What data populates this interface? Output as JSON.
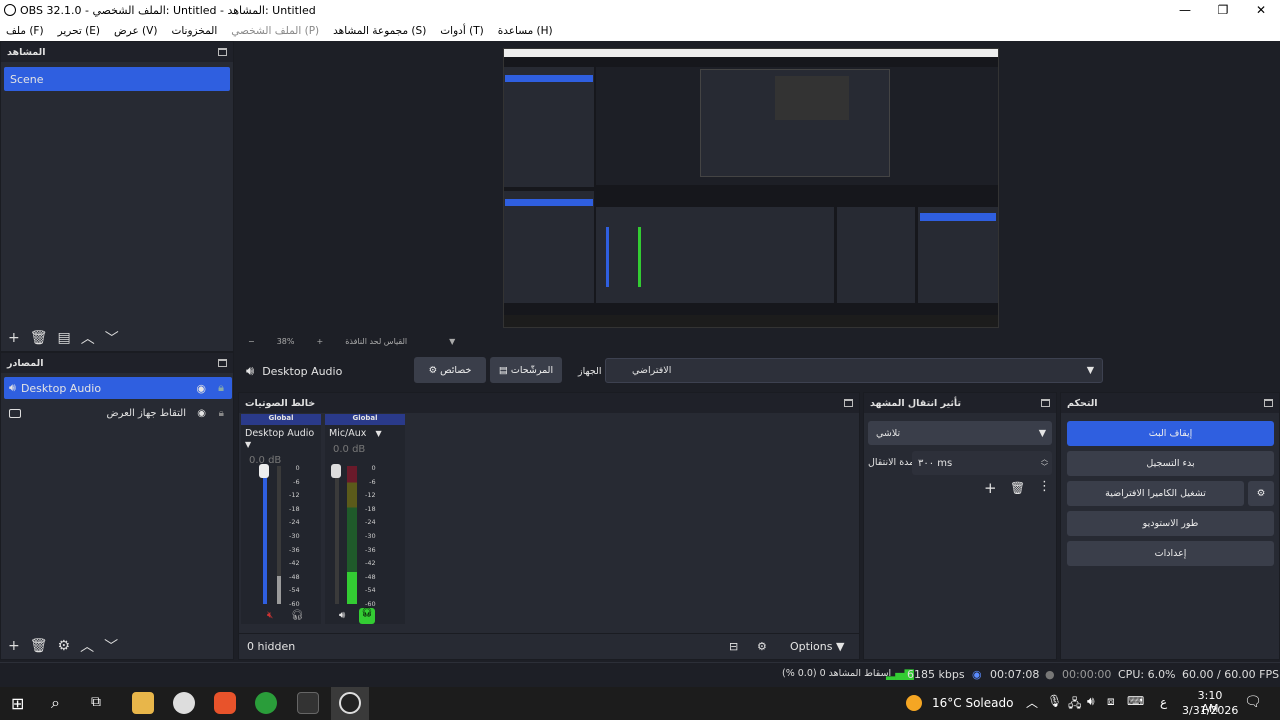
{
  "window": {
    "title": "OBS 32.1.0 - الملف الشخصي: Untitled - المشاهد: Untitled",
    "controls": [
      "—",
      "❐",
      "✕"
    ]
  },
  "menu": [
    {
      "label": "ملف (F)",
      "enabled": true
    },
    {
      "label": "تحرير (E)",
      "enabled": true
    },
    {
      "label": "عرض (V)",
      "enabled": true
    },
    {
      "label": "المخزونات",
      "enabled": true
    },
    {
      "label": "الملف الشخصي (P)",
      "enabled": false
    },
    {
      "label": "مجموعة المشاهد (S)",
      "enabled": true
    },
    {
      "label": "أدوات (T)",
      "enabled": true
    },
    {
      "label": "مساعدة (H)",
      "enabled": true
    }
  ],
  "scenes": {
    "header": "المشاهد",
    "items": [
      "Scene"
    ],
    "selected": 0
  },
  "sources": {
    "header": "المصادر",
    "items": [
      {
        "name": "Desktop Audio",
        "type": "audio",
        "selected": true
      },
      {
        "name": "التقاط جهاز العرض",
        "type": "display",
        "selected": false
      }
    ]
  },
  "preview": {
    "zoom": "38%",
    "zoom_label": "القياس لحد النافذة"
  },
  "context": {
    "source_name": "Desktop Audio",
    "properties": "خصائص",
    "filters": "المرشّحات",
    "device_label": "الجهاز",
    "device_value": "الافتراضي"
  },
  "mixer": {
    "header": "خالط الصوتيات",
    "channels": [
      {
        "scope": "Global",
        "name": "Desktop Audio",
        "db": "0.0 dB",
        "level": 0.2
      },
      {
        "scope": "Global",
        "name": "Mic/Aux",
        "db": "0.0 dB",
        "level": 0.25
      }
    ],
    "ticks": [
      "0",
      "-6",
      "-12",
      "-18",
      "-24",
      "-30",
      "-36",
      "-42",
      "-48",
      "-54",
      "-60"
    ],
    "hidden": "0 hidden",
    "options": "Options"
  },
  "transitions": {
    "header": "تأثير انتقال المشهد",
    "type": "تلاشي",
    "duration_label": "مدة الانتقال",
    "duration_value": "٣٠٠ ms"
  },
  "controls": {
    "header": "التحكم",
    "stop_stream": "إيقاف البث",
    "start_record": "بدء التسجيل",
    "virtual_cam": "تشغيل الكاميرا الافتراضية",
    "studio_mode": "طور الاستوديو",
    "settings": "إعدادات"
  },
  "status": {
    "dropped": "إسقاط المشاهد 0 (0.0 %)",
    "bitrate": "6185 kbps",
    "stream_time": "00:07:08",
    "rec_time": "00:00:00",
    "cpu": "CPU: 6.0%",
    "fps": "60.00 / 60.00 FPS"
  },
  "taskbar": {
    "weather": "16°C  Soleado",
    "time": "3:10 AM",
    "date": "3/31/2026",
    "lang": "ع"
  },
  "colors": {
    "accent": "#2f5fe0",
    "dock": "#272a33",
    "bg": "#1d1f26"
  }
}
